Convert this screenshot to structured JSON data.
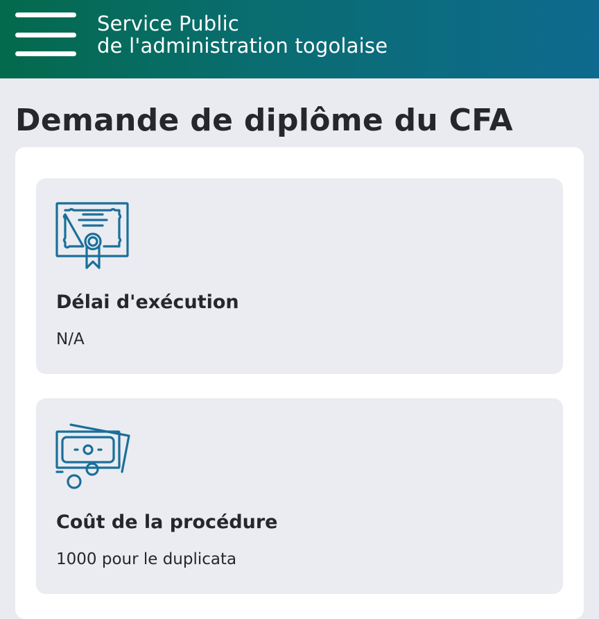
{
  "header": {
    "brand_line1": "Service Public",
    "brand_line2": "de l'administration togolaise",
    "menu_icon": "hamburger-menu-icon"
  },
  "page": {
    "title": "Demande de diplôme du CFA"
  },
  "cards": [
    {
      "icon": "certificate-icon",
      "label": "Délai d'exécution",
      "value": "N/A"
    },
    {
      "icon": "money-coins-icon",
      "label": "Coût de la procédure",
      "value": "1000 pour le duplicata"
    }
  ],
  "colors": {
    "header_gradient_start": "#036a4c",
    "header_gradient_end": "#0e6a8e",
    "icon_accent": "#1a6f99",
    "page_background": "#e9ebf0",
    "card_background": "#eaecf1"
  }
}
